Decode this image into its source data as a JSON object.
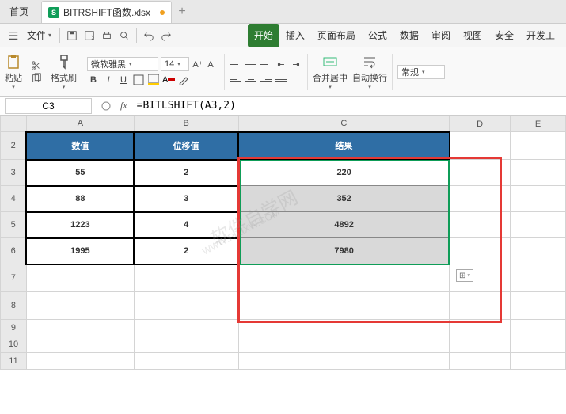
{
  "tabs": {
    "home": "首页",
    "filename": "BITRSHIFT函数.xlsx"
  },
  "qa": {
    "file_menu": "文件"
  },
  "ribbon": {
    "start": "开始",
    "insert": "插入",
    "layout": "页面布局",
    "formula": "公式",
    "data": "数据",
    "review": "审阅",
    "view": "视图",
    "security": "安全",
    "dev": "开发工",
    "paste": "粘贴",
    "format_painter": "格式刷",
    "merge": "合并居中",
    "wrap": "自动换行",
    "general": "常规",
    "font_name": "微软雅黑",
    "font_size": "14",
    "bold": "B",
    "italic": "I",
    "underline": "U",
    "a_plus": "A⁺",
    "a_minus": "A⁻"
  },
  "formula": {
    "cell": "C3",
    "value": "=BITLSHIFT(A3,2)"
  },
  "cols": {
    "a": "A",
    "b": "B",
    "c": "C",
    "d": "D",
    "e": "E"
  },
  "rows": {
    "r2": "2",
    "r3": "3",
    "r4": "4",
    "r5": "5",
    "r6": "6",
    "r7": "7",
    "r8": "8",
    "r9": "9",
    "r10": "10",
    "r11": "11"
  },
  "headers": {
    "num": "数值",
    "shift": "位移值",
    "result": "结果"
  },
  "table": [
    {
      "a": "55",
      "b": "2",
      "c": "220"
    },
    {
      "a": "88",
      "b": "3",
      "c": "352"
    },
    {
      "a": "1223",
      "b": "4",
      "c": "4892"
    },
    {
      "a": "1995",
      "b": "2",
      "c": "7980"
    }
  ],
  "smart_tag": "⊞",
  "chart_data": {
    "type": "table",
    "title": "BITLSHIFT",
    "columns": [
      "数值",
      "位移值",
      "结果"
    ],
    "rows": [
      [
        55,
        2,
        220
      ],
      [
        88,
        3,
        352
      ],
      [
        1223,
        4,
        4892
      ],
      [
        1995,
        2,
        7980
      ]
    ]
  }
}
